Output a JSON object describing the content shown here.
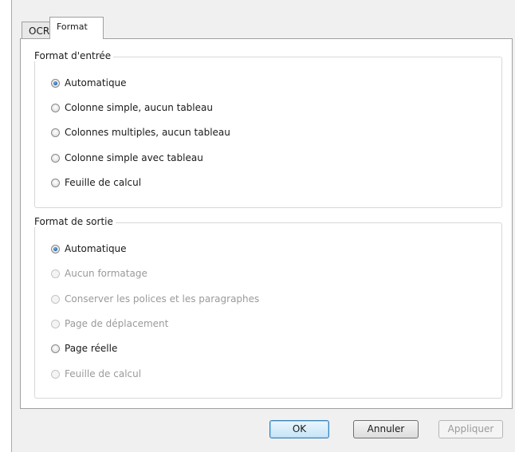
{
  "tabs": [
    {
      "label": "OCR",
      "active": false
    },
    {
      "label": "Format",
      "active": true
    }
  ],
  "input_group": {
    "title": "Format d'entrée",
    "options": [
      {
        "label": "Automatique",
        "checked": true,
        "disabled": false
      },
      {
        "label": "Colonne simple, aucun tableau",
        "checked": false,
        "disabled": false
      },
      {
        "label": "Colonnes multiples, aucun tableau",
        "checked": false,
        "disabled": false
      },
      {
        "label": "Colonne simple avec tableau",
        "checked": false,
        "disabled": false
      },
      {
        "label": "Feuille de calcul",
        "checked": false,
        "disabled": false
      }
    ]
  },
  "output_group": {
    "title": "Format de sortie",
    "options": [
      {
        "label": "Automatique",
        "checked": true,
        "disabled": false
      },
      {
        "label": "Aucun formatage",
        "checked": false,
        "disabled": true
      },
      {
        "label": "Conserver les polices et les paragraphes",
        "checked": false,
        "disabled": true
      },
      {
        "label": "Page de déplacement",
        "checked": false,
        "disabled": true
      },
      {
        "label": "Page réelle",
        "checked": false,
        "disabled": false
      },
      {
        "label": "Feuille de calcul",
        "checked": false,
        "disabled": true
      }
    ]
  },
  "buttons": {
    "ok": "OK",
    "cancel": "Annuler",
    "apply": "Appliquer"
  }
}
